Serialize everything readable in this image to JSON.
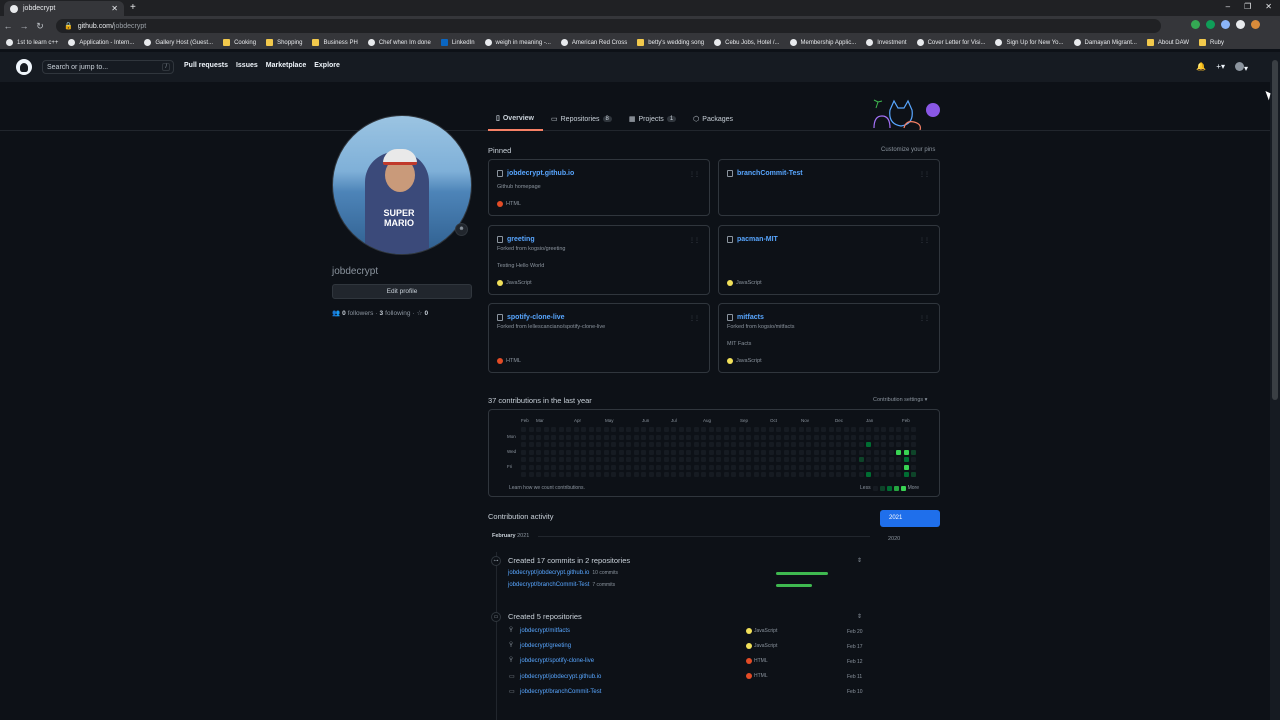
{
  "browser": {
    "tab_title": "jobdecrypt",
    "new_tab": "+",
    "window_controls": [
      "–",
      "❐",
      "✕"
    ],
    "url_host": "github.com/",
    "url_path": "jobdecrypt",
    "bookmarks": [
      {
        "label": "1st to learn c++",
        "icon": "site"
      },
      {
        "label": "Application - Intern...",
        "icon": "site"
      },
      {
        "label": "Gallery Host (Guest...",
        "icon": "site"
      },
      {
        "label": "Cooking",
        "icon": "folder"
      },
      {
        "label": "Shopping",
        "icon": "folder"
      },
      {
        "label": "Business PH",
        "icon": "folder"
      },
      {
        "label": "Chef when Im done",
        "icon": "site"
      },
      {
        "label": "LinkedIn",
        "icon": "linkedin"
      },
      {
        "label": "weigh in meaning -...",
        "icon": "site"
      },
      {
        "label": "American Red Cross",
        "icon": "site"
      },
      {
        "label": "betty's wedding song",
        "icon": "folder"
      },
      {
        "label": "Cebu Jobs, Hotel /...",
        "icon": "site"
      },
      {
        "label": "Membership Applic...",
        "icon": "site"
      },
      {
        "label": "Investment",
        "icon": "site"
      },
      {
        "label": "Cover Letter for Visi...",
        "icon": "site"
      },
      {
        "label": "Sign Up for New Yo...",
        "icon": "site"
      },
      {
        "label": "Damayan Migrant...",
        "icon": "site"
      },
      {
        "label": "About DAW",
        "icon": "folder"
      },
      {
        "label": "Ruby",
        "icon": "folder"
      }
    ]
  },
  "header": {
    "search_placeholder": "Search or jump to...",
    "slash": "/",
    "nav": [
      "Pull requests",
      "Issues",
      "Marketplace",
      "Explore"
    ],
    "bell": "🔔",
    "plus": "+▾",
    "avatar": "▾"
  },
  "profile": {
    "shirt_text": "SUPER MARIO",
    "status_emoji": "☻",
    "username": "jobdecrypt",
    "edit_button": "Edit profile",
    "followers_count": "0",
    "followers_label": "followers",
    "sep": "·",
    "following_count": "3",
    "following_label": "following",
    "stars_count": "0"
  },
  "tabs": [
    {
      "label": "Overview",
      "count": ""
    },
    {
      "label": "Repositories",
      "count": "8"
    },
    {
      "label": "Projects",
      "count": "1"
    },
    {
      "label": "Packages",
      "count": ""
    }
  ],
  "pinned": {
    "title": "Pinned",
    "customize": "Customize your pins",
    "cards": [
      {
        "name": "jobdecrypt.github.io",
        "forked": "",
        "desc": "Github homepage",
        "lang": "HTML",
        "lang_color": "#e34c26"
      },
      {
        "name": "branchCommit-Test",
        "forked": "",
        "desc": "",
        "lang": "",
        "lang_color": ""
      },
      {
        "name": "greeting",
        "forked": "Forked from kogsio/greeting",
        "desc": "Testing Hello World",
        "lang": "JavaScript",
        "lang_color": "#f1e05a"
      },
      {
        "name": "pacman-MIT",
        "forked": "",
        "desc": "",
        "lang": "JavaScript",
        "lang_color": "#f1e05a"
      },
      {
        "name": "spotify-clone-live",
        "forked": "Forked from lellescanciano/spotify-clone-live",
        "desc": "",
        "lang": "HTML",
        "lang_color": "#e34c26"
      },
      {
        "name": "mitfacts",
        "forked": "Forked from kogsio/mitfacts",
        "desc": "MIT Facts",
        "lang": "JavaScript",
        "lang_color": "#f1e05a"
      }
    ]
  },
  "contributions": {
    "title": "37 contributions in the last year",
    "settings": "Contribution settings ▾",
    "months": [
      "Feb",
      "Mar",
      "Apr",
      "May",
      "Jun",
      "Jul",
      "Aug",
      "Sep",
      "Oct",
      "Nov",
      "Dec",
      "Jan",
      "Feb"
    ],
    "days": [
      "Mon",
      "Wed",
      "Fri"
    ],
    "learn": "Learn how we count contributions.",
    "less": "Less",
    "more": "More",
    "active_cells": [
      {
        "week": 46,
        "day": 2,
        "level": 2
      },
      {
        "week": 45,
        "day": 4,
        "level": 1
      },
      {
        "week": 46,
        "day": 6,
        "level": 2
      },
      {
        "week": 50,
        "day": 3,
        "level": 4
      },
      {
        "week": 51,
        "day": 3,
        "level": 4
      },
      {
        "week": 51,
        "day": 4,
        "level": 2
      },
      {
        "week": 51,
        "day": 5,
        "level": 4
      },
      {
        "week": 51,
        "day": 6,
        "level": 2
      },
      {
        "week": 52,
        "day": 3,
        "level": 1
      },
      {
        "week": 52,
        "day": 6,
        "level": 1
      }
    ],
    "colors": [
      "#161b22",
      "#0e4429",
      "#006d32",
      "#26a641",
      "#39d353"
    ]
  },
  "activity": {
    "title": "Contribution activity",
    "years": [
      "2021",
      "2020"
    ],
    "month": "February",
    "month_year": "2021",
    "commits_title": "Created 17 commits in 2 repositories",
    "commit_repos": [
      {
        "name": "jobdecrypt/jobdecrypt.github.io",
        "count": "10 commits",
        "share": 0.59
      },
      {
        "name": "jobdecrypt/branchCommit-Test",
        "count": "7 commits",
        "share": 0.41
      }
    ],
    "repos_title": "Created 5 repositories",
    "repos": [
      {
        "name": "jobdecrypt/mitfacts",
        "icon": "fork",
        "lang": "JavaScript",
        "color": "#f1e05a",
        "date": "Feb 20"
      },
      {
        "name": "jobdecrypt/greeting",
        "icon": "fork",
        "lang": "JavaScript",
        "color": "#f1e05a",
        "date": "Feb 17"
      },
      {
        "name": "jobdecrypt/spotify-clone-live",
        "icon": "fork",
        "lang": "HTML",
        "color": "#e34c26",
        "date": "Feb 12"
      },
      {
        "name": "jobdecrypt/jobdecrypt.github.io",
        "icon": "repo",
        "lang": "HTML",
        "color": "#e34c26",
        "date": "Feb 11"
      },
      {
        "name": "jobdecrypt/branchCommit-Test",
        "icon": "repo",
        "lang": "",
        "color": "",
        "date": "Feb 10"
      }
    ]
  }
}
